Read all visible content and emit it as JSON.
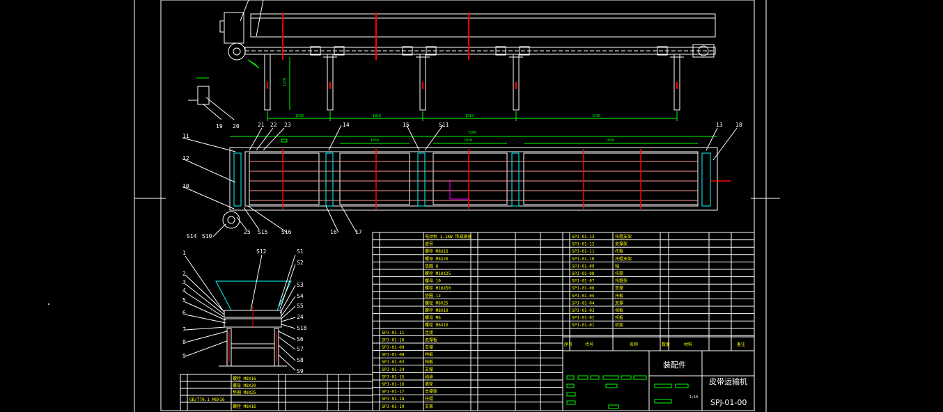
{
  "drawing": {
    "title_cn": "皮带运输机",
    "drawing_no": "SPJ-01-00",
    "assembly_label": "装配件",
    "scale": "1:10"
  },
  "dimensions": {
    "overall": "7200",
    "top_spans": [
      "1530",
      "1810",
      "1810",
      "1530"
    ],
    "bay_spans": [
      "1650",
      "1650",
      "1650"
    ],
    "height": "1220"
  },
  "labels": {
    "plan_view": [
      "11",
      "12",
      "10",
      "21",
      "22",
      "23",
      "14",
      "15",
      "S11",
      "13",
      "18",
      "S14",
      "S10",
      "25",
      "S15",
      "S16",
      "16",
      "17"
    ],
    "side_view": [
      "19",
      "20"
    ],
    "section_left": [
      "1",
      "2",
      "3",
      "4",
      "5",
      "6",
      "7",
      "8",
      "9"
    ],
    "section_top": [
      "S12"
    ],
    "section_right": [
      "S1",
      "S2",
      "S3",
      "S4",
      "S5",
      "24",
      "S18",
      "S6",
      "S7",
      "S8",
      "S9"
    ]
  },
  "bom_header": {
    "seq": "序号",
    "code": "代号",
    "name": "名称",
    "qty": "数量",
    "material": "材料",
    "note": "备注"
  },
  "bom_left": [
    {
      "code": "",
      "name": "电动机 1.1KW 带减速器"
    },
    {
      "code": "",
      "name": "皮带"
    },
    {
      "code": "",
      "name": "螺栓 M8X16"
    },
    {
      "code": "",
      "name": "螺母 M8X20"
    },
    {
      "code": "",
      "name": "垫圈 8"
    },
    {
      "code": "",
      "name": "螺栓 M10X25"
    },
    {
      "code": "",
      "name": "螺母 10"
    },
    {
      "code": "",
      "name": "螺栓 M16X50"
    },
    {
      "code": "",
      "name": "垫圈 12"
    },
    {
      "code": "",
      "name": "螺栓 M8X25"
    },
    {
      "code": "",
      "name": "螺栓 M8X10"
    },
    {
      "code": "",
      "name": "螺母 M6"
    },
    {
      "code": "",
      "name": "螺栓 M6X16"
    },
    {
      "code": "SPJ-01-11",
      "name": "连接"
    },
    {
      "code": "SPJ-01-10",
      "name": "支撑板"
    },
    {
      "code": "SPJ-01-09",
      "name": "支撑"
    },
    {
      "code": "SPJ-01-08",
      "name": "挡板"
    },
    {
      "code": "SPJ-01-03",
      "name": "挡板"
    },
    {
      "code": "SPJ-01-24",
      "name": "支撑"
    },
    {
      "code": "SPJ-01-15",
      "name": "轴承"
    },
    {
      "code": "SPJ-01-16",
      "name": "滚轮"
    },
    {
      "code": "SPJ-01-17",
      "name": "支撑架"
    },
    {
      "code": "SPJ-01-18",
      "name": "托辊"
    },
    {
      "code": "SPJ-01-19",
      "name": "支架"
    }
  ],
  "bom_mid": [
    {
      "code": "SPJ-01-13",
      "name": "托辊支架"
    },
    {
      "code": "SPJ-01-12",
      "name": "支撑架"
    },
    {
      "code": "SPJ-01-11",
      "name": "托板"
    },
    {
      "code": "SPJ-01-10",
      "name": "托辊支架"
    },
    {
      "code": "SPJ-01-09",
      "name": "轴"
    },
    {
      "code": "SPJ-01-08",
      "name": "托辊"
    },
    {
      "code": "SPJ-01-07",
      "name": "托辊架"
    },
    {
      "code": "SPJ-01-06",
      "name": "支撑"
    },
    {
      "code": "SPJ-01-05",
      "name": "托板"
    },
    {
      "code": "SPJ-01-04",
      "name": "支撑"
    },
    {
      "code": "SPJ-01-03",
      "name": "挡板"
    },
    {
      "code": "SPJ-01-02",
      "name": "托板"
    },
    {
      "code": "SPJ-01-01",
      "name": "机架"
    }
  ],
  "bom_small": [
    {
      "name": "螺栓 M8X16"
    },
    {
      "name": "螺母 M8X20"
    },
    {
      "name": "垫圈 M8X25"
    },
    {
      "name": "GB/T70.1 M6X16"
    },
    {
      "name": "螺栓 M8X16"
    }
  ],
  "colors": {
    "frame": "#ffffff",
    "leader": "#ffffff",
    "dimension": "#00ff00",
    "centerline": "#ff0000",
    "hidden": "#ff0000",
    "accent": "#00ffff",
    "axis": "#ff00ff",
    "text_yellow": "#ffff00"
  }
}
